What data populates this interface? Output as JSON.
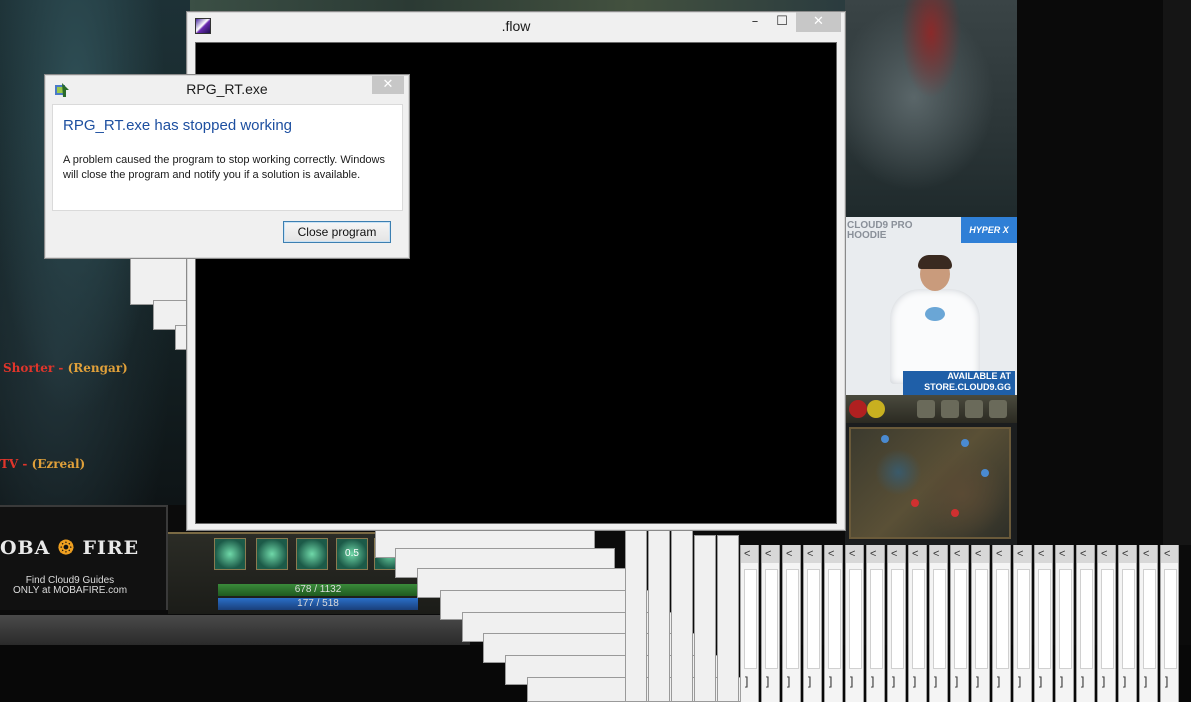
{
  "flow_window": {
    "title": ".flow",
    "minimize_glyph": "–",
    "maximize_glyph": "☐",
    "close_glyph": "✕"
  },
  "error_dialog": {
    "title": "RPG_RT.exe",
    "close_glyph": "✕",
    "heading": "RPG_RT.exe has stopped working",
    "message": "A problem caused the program to stop working correctly. Windows will close the program and notify you if a solution is available.",
    "button": "Close program"
  },
  "background": {
    "ad": {
      "title": "CLOUD9 PRO HOODIE",
      "brand": "HYPER X",
      "availability": "AVAILABLE AT STORE.CLOUD9.GG"
    },
    "chat_lines": [
      {
        "name": "Shorter",
        "sep": " - ",
        "champ": "(Rengar)"
      },
      {
        "name": "TV",
        "sep": " - ",
        "champ": "(Ezreal)"
      }
    ],
    "mobafire": {
      "logo_left": "OBA",
      "logo_right": "FIRE",
      "tagline_1": "Find Cloud9 Guides",
      "tagline_2": "ONLY at MOBAFIRE.com"
    },
    "hud": {
      "hp": "678 / 1132",
      "mana": "177 / 518",
      "cooldown": "0.5"
    },
    "tile_arrow": "<",
    "tile_foot": "]"
  },
  "colors": {
    "error_heading": "#1d4fa0",
    "button_border": "#3c7fb1",
    "chat_name": "#e0352b",
    "chat_champ": "#e0a03a"
  }
}
